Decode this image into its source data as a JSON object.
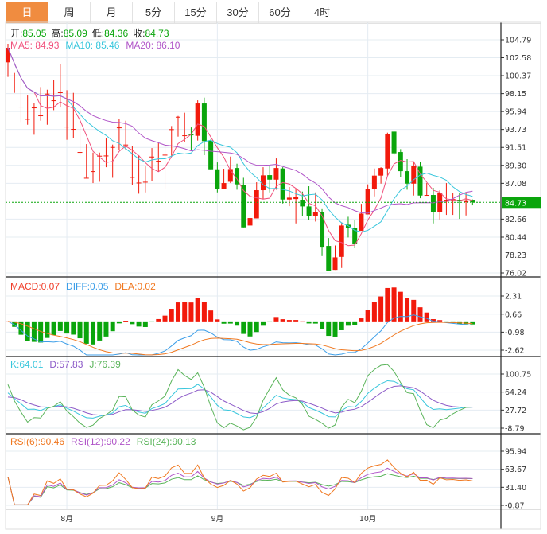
{
  "tabs": [
    {
      "label": "日",
      "active": true
    },
    {
      "label": "周"
    },
    {
      "label": "月"
    },
    {
      "label": "5分"
    },
    {
      "label": "15分"
    },
    {
      "label": "30分"
    },
    {
      "label": "60分"
    },
    {
      "label": "4时"
    }
  ],
  "header": {
    "open_label": "开:",
    "open": "85.05",
    "high_label": "高:",
    "high": "85.09",
    "low_label": "低:",
    "low": "84.36",
    "close_label": "收:",
    "close": "84.73",
    "ma5": "MA5: 84.93",
    "ma10": "MA10: 85.46",
    "ma20": "MA20: 86.10"
  },
  "macd_header": {
    "macd": "MACD:0.07",
    "diff": "DIFF:0.05",
    "dea": "DEA:0.02"
  },
  "kdj_header": {
    "k": "K:64.01",
    "d": "D:57.83",
    "j": "J:76.39"
  },
  "rsi_header": {
    "rsi6": "RSI(6):90.46",
    "rsi12": "RSI(12):90.22",
    "rsi24": "RSI(24):90.13"
  },
  "colors": {
    "up": "#f21a0c",
    "down": "#0aa50c",
    "ma5": "#f0507c",
    "ma10": "#38c6dc",
    "ma20": "#b055c8",
    "diff": "#3c9ee8",
    "dea": "#f07820",
    "k": "#38c6dc",
    "d": "#8c5ac8",
    "j": "#5ab45a",
    "rsi6": "#f07820",
    "rsi12": "#b055c8",
    "rsi24": "#5ab45a",
    "active_tab": "#f08c40"
  },
  "chart_data": {
    "type": "candlestick",
    "candle_format": [
      "open",
      "high",
      "low",
      "close"
    ],
    "candles": [
      [
        102.01,
        104.3,
        100.21,
        103.81
      ],
      [
        99.85,
        100.7,
        98.24,
        99.88
      ],
      [
        96.5,
        99.94,
        94.64,
        96.54
      ],
      [
        95.0,
        97.91,
        94.31,
        95.03
      ],
      [
        96.4,
        96.93,
        93.07,
        96.44
      ],
      [
        95.42,
        98.96,
        94.8,
        95.46
      ],
      [
        98.1,
        98.63,
        94.31,
        98.14
      ],
      [
        97.28,
        99.81,
        96.11,
        97.32
      ],
      [
        98.27,
        101.84,
        96.44,
        98.31
      ],
      [
        94.04,
        98.57,
        92.45,
        94.08
      ],
      [
        93.75,
        98.24,
        92.67,
        93.79
      ],
      [
        90.9,
        96.54,
        90.48,
        90.94
      ],
      [
        87.72,
        91.92,
        87.76,
        87.76
      ],
      [
        88.54,
        90.87,
        87.11,
        88.58
      ],
      [
        90.44,
        90.87,
        87.27,
        90.48
      ],
      [
        90.47,
        92.61,
        89.07,
        90.51
      ],
      [
        91.52,
        91.86,
        87.76,
        91.56
      ],
      [
        93.94,
        94.97,
        91.2,
        93.98
      ],
      [
        91.82,
        94.8,
        91.2,
        91.86
      ],
      [
        87.82,
        91.69,
        86.85,
        87.86
      ],
      [
        87.13,
        90.55,
        85.8,
        87.17
      ],
      [
        87.23,
        89.17,
        85.96,
        87.27
      ],
      [
        90.34,
        91.43,
        87.34,
        90.38
      ],
      [
        89.82,
        92.02,
        88.5,
        89.86
      ],
      [
        90.57,
        92.02,
        86.36,
        90.61
      ],
      [
        93.72,
        94.15,
        90.48,
        93.76
      ],
      [
        95.25,
        95.39,
        92.84,
        95.29
      ],
      [
        92.96,
        95.79,
        92.18,
        93.0
      ],
      [
        93.1,
        93.98,
        91.2,
        93.0
      ],
      [
        92.94,
        97.32,
        92.35,
        96.93
      ],
      [
        96.93,
        97.65,
        90.55,
        92.28
      ],
      [
        92.35,
        92.5,
        88.81,
        88.81
      ],
      [
        88.81,
        89.66,
        85.96,
        86.36
      ],
      [
        86.36,
        88.88,
        86.36,
        87.11
      ],
      [
        87.27,
        90.38,
        87.11,
        88.84
      ],
      [
        88.97,
        89.5,
        86.29,
        86.95
      ],
      [
        86.91,
        87.76,
        81.64,
        81.64
      ],
      [
        81.87,
        84.29,
        81.28,
        82.79
      ],
      [
        82.75,
        87.21,
        82.75,
        86.23
      ],
      [
        86.23,
        89.07,
        85.14,
        88.06
      ],
      [
        88.09,
        89.24,
        85.96,
        87.53
      ],
      [
        87.53,
        90.15,
        86.29,
        88.97
      ],
      [
        88.91,
        89.07,
        84.59,
        85.08
      ],
      [
        85.08,
        86.62,
        84.26,
        85.31
      ],
      [
        85.14,
        86.45,
        82.13,
        85.41
      ],
      [
        85.05,
        86.06,
        83.02,
        84.23
      ],
      [
        84.23,
        86.72,
        82.52,
        83.02
      ],
      [
        83.02,
        85.96,
        82.36,
        83.51
      ],
      [
        83.57,
        83.99,
        78.1,
        79.25
      ],
      [
        79.35,
        80.33,
        76.3,
        76.3
      ],
      [
        76.4,
        79.41,
        76.4,
        77.94
      ],
      [
        78.0,
        82.26,
        76.63,
        81.87
      ],
      [
        81.97,
        82.95,
        80.4,
        81.54
      ],
      [
        81.61,
        82.52,
        79.15,
        79.64
      ],
      [
        81.22,
        84.55,
        81.22,
        83.34
      ],
      [
        83.24,
        86.95,
        83.24,
        86.39
      ],
      [
        86.36,
        88.91,
        85.47,
        88.03
      ],
      [
        88.03,
        89.07,
        87.04,
        88.97
      ],
      [
        88.91,
        93.33,
        88.03,
        93.17
      ],
      [
        93.46,
        93.59,
        90.55,
        90.78
      ],
      [
        90.94,
        91.3,
        87.86,
        88.58
      ],
      [
        88.58,
        90.06,
        86.29,
        87.04
      ],
      [
        87.04,
        89.66,
        85.57,
        89.24
      ],
      [
        89.14,
        89.73,
        85.24,
        85.57
      ],
      [
        85.57,
        87.11,
        85.57,
        85.64
      ],
      [
        85.64,
        86.52,
        82.13,
        83.57
      ],
      [
        83.57,
        86.23,
        82.62,
        85.9
      ],
      [
        84.82,
        87.11,
        83.18,
        85.05
      ],
      [
        84.98,
        85.93,
        83.18,
        85.14
      ],
      [
        85.05,
        85.86,
        82.69,
        84.88
      ],
      [
        84.75,
        85.96,
        83.11,
        84.98
      ],
      [
        85.05,
        85.09,
        84.36,
        84.73
      ]
    ],
    "last_price": "84.73",
    "price_ticks": [
      "104.79",
      "102.58",
      "100.37",
      "98.15",
      "95.94",
      "93.73",
      "91.51",
      "89.30",
      "87.08",
      "82.66",
      "80.44",
      "78.23",
      "76.02"
    ],
    "price_range": [
      76.02,
      104.79
    ],
    "macd_ticks": [
      "2.31",
      "0.66",
      "-0.98",
      "-2.62"
    ],
    "macd_range": [
      -2.62,
      2.31
    ],
    "kdj_ticks": [
      "100.75",
      "64.24",
      "27.72",
      "-8.79"
    ],
    "kdj_range": [
      -8.79,
      100.75
    ],
    "rsi_ticks": [
      "95.94",
      "63.67",
      "31.40",
      "-0.87"
    ],
    "rsi_range": [
      -0.87,
      95.94
    ],
    "x_labels": [
      {
        "label": "8月",
        "index": 9
      },
      {
        "label": "9月",
        "index": 32
      },
      {
        "label": "10月",
        "index": 55
      }
    ],
    "grid": true
  }
}
